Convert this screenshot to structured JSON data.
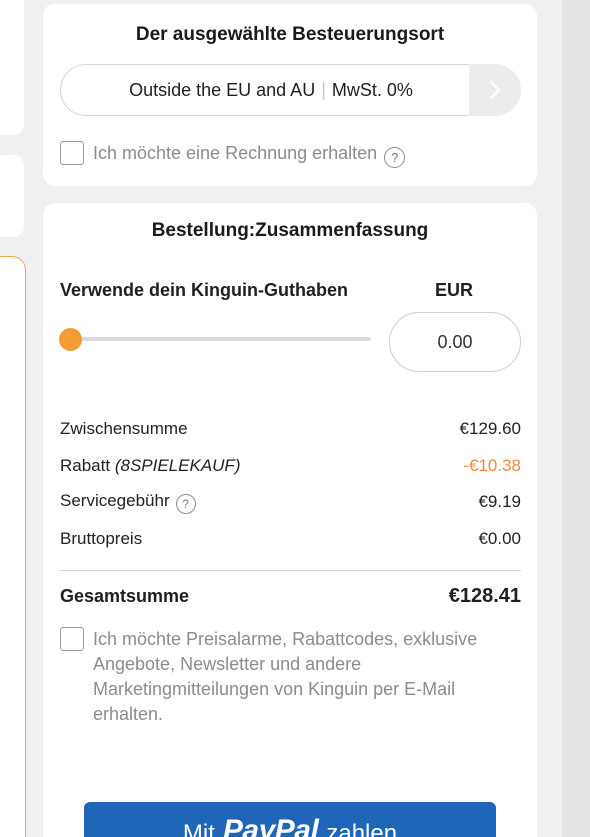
{
  "tax_location": {
    "title": "Der ausgewählte Besteuerungsort",
    "selected_region": "Outside the EU and AU",
    "separator": "|",
    "vat_label": "MwSt. 0%",
    "invoice_checkbox_label": "Ich möchte eine Rechnung erhalten",
    "help_glyph": "?"
  },
  "order_summary": {
    "title": "Bestellung:Zusammenfassung",
    "credit": {
      "label": "Verwende dein Kinguin-Guthaben",
      "currency": "EUR",
      "amount": "0.00",
      "slider_level": 0
    },
    "line_items": [
      {
        "label": "Zwischensumme",
        "value": "€129.60"
      },
      {
        "label": "Rabatt",
        "code": "(8SPIELEKAUF)",
        "value": "-€10.38"
      },
      {
        "label": "Servicegebühr",
        "value": "€9.19"
      },
      {
        "label": "Bruttopreis",
        "value": "€0.00"
      }
    ],
    "total": {
      "label": "Gesamtsumme",
      "value": "€128.41"
    },
    "marketing_checkbox_label": "Ich möchte Preisalarme, Rabattcodes, exklusive Angebote, Newsletter und andere Marketingmitteilungen von Kinguin per E-Mail erhalten.",
    "paypal_button": {
      "prefix": "Mit",
      "brand": "PayPal",
      "suffix": "zahlen"
    },
    "help_glyph": "?"
  },
  "colors": {
    "accent_orange": "#f39b34",
    "discount_orange": "#f08a3c",
    "paypal_blue": "#1f65b8"
  },
  "icons": {
    "tax_arrow": "chevron-right-icon",
    "help": "question-circle-icon"
  }
}
